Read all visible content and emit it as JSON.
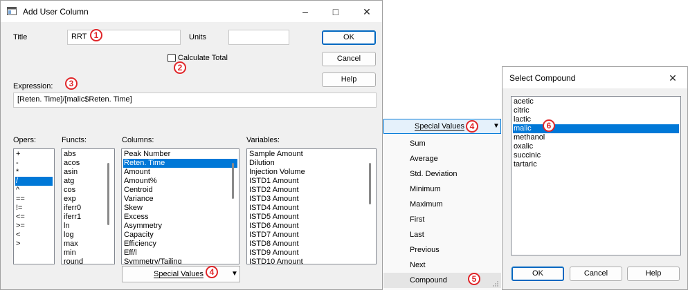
{
  "dialog1": {
    "title": "Add User Column",
    "title_label": "Title",
    "title_value": "RRT",
    "units_label": "Units",
    "units_value": "",
    "calc_total_label": "Calculate Total",
    "expression_label": "Expression:",
    "expression_value": "[Reten. Time]/[malic$Reten. Time]",
    "ok_label": "OK",
    "cancel_label": "Cancel",
    "help_label": "Help",
    "opers_label": "Opers:",
    "functs_label": "Functs:",
    "columns_label": "Columns:",
    "variables_label": "Variables:",
    "opers": [
      "+",
      "-",
      "*",
      "/",
      "^",
      "==",
      "!=",
      "<=",
      ">=",
      "<",
      ">"
    ],
    "opers_selected": "/",
    "functs": [
      "abs",
      "acos",
      "asin",
      "atg",
      "cos",
      "exp",
      "iferr0",
      "iferr1",
      "ln",
      "log",
      "max",
      "min",
      "round"
    ],
    "columns": [
      "Peak Number",
      "Reten. Time",
      "Amount",
      "Amount%",
      "Centroid",
      "Variance",
      "Skew",
      "Excess",
      "Asymmetry",
      "Capacity",
      "Efficiency",
      "Eff/l",
      "Symmetry/Tailing"
    ],
    "columns_selected": "Reten. Time",
    "variables": [
      "Sample Amount",
      "Dilution",
      "Injection Volume",
      "ISTD1 Amount",
      "ISTD2 Amount",
      "ISTD3 Amount",
      "ISTD4 Amount",
      "ISTD5 Amount",
      "ISTD6 Amount",
      "ISTD7 Amount",
      "ISTD8 Amount",
      "ISTD9 Amount",
      "ISTD10 Amount"
    ],
    "special_values_label": "Special Values"
  },
  "menu": {
    "button_label": "Special Values",
    "items": [
      "Sum",
      "Average",
      "Std. Deviation",
      "Minimum",
      "Maximum",
      "First",
      "Last",
      "Previous",
      "Next",
      "Compound"
    ],
    "highlighted": "Compound"
  },
  "dialog2": {
    "title": "Select Compound",
    "compounds": [
      "acetic",
      "citric",
      "lactic",
      "malic",
      "methanol",
      "oxalic",
      "succinic",
      "tartaric"
    ],
    "selected": "malic",
    "ok_label": "OK",
    "cancel_label": "Cancel",
    "help_label": "Help"
  },
  "badges": [
    "1",
    "2",
    "3",
    "4",
    "4",
    "5",
    "6"
  ],
  "colors": {
    "annotation": "#e0262a",
    "selection": "#0078d7",
    "dialog_bg": "#f0f0f0"
  },
  "icons": {
    "app": "window-icon",
    "minimize": "minimize-icon",
    "maximize": "maximize-icon",
    "close": "close-icon",
    "dropdown": "triangle-down-icon"
  }
}
